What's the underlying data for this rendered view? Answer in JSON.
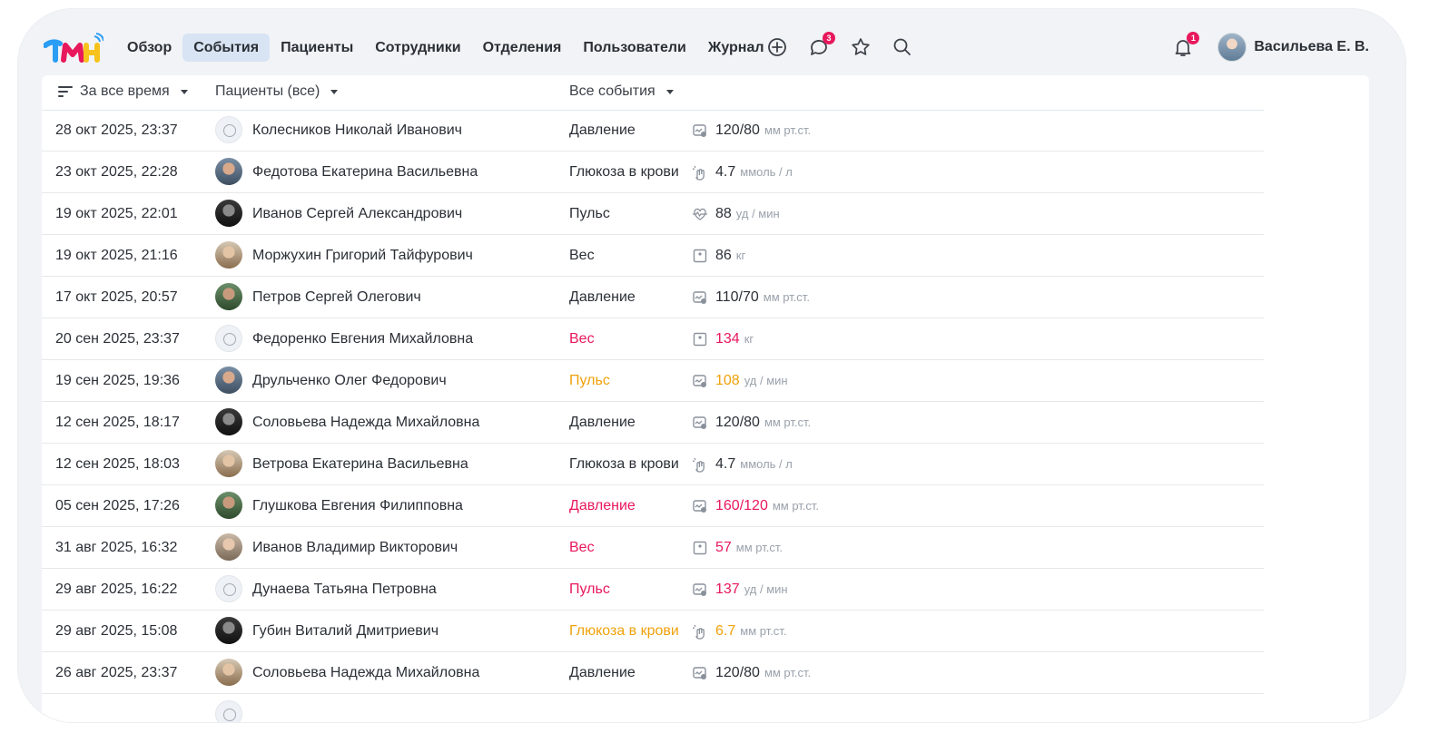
{
  "nav": {
    "items": [
      {
        "label": "Обзор",
        "active": false
      },
      {
        "label": "События",
        "active": true
      },
      {
        "label": "Пациенты",
        "active": false
      },
      {
        "label": "Сотрудники",
        "active": false
      },
      {
        "label": "Отделения",
        "active": false
      },
      {
        "label": "Пользователи",
        "active": false
      },
      {
        "label": "Журнал",
        "active": false
      }
    ],
    "icons": [
      "add-circle-icon",
      "chat-icon",
      "star-icon",
      "search-icon"
    ],
    "chat_badge": "3",
    "notifications_badge": "1"
  },
  "user": {
    "name": "Васильева Е. В."
  },
  "filters": {
    "period": "За все время",
    "patients": "Пациенты (все)",
    "events": "Все события"
  },
  "colors": {
    "accent_bg": "#d8e4f3",
    "alert": "#e8185c",
    "warning": "#f0a10a"
  },
  "events": [
    {
      "date": "28 окт 2025, 23:37",
      "patient": "Колесников Николай Иванович",
      "type": "Давление",
      "value": "120/80",
      "unit": "мм рт.ст.",
      "status": "normal",
      "icon": "pressure-icon",
      "avatar": "placeholder"
    },
    {
      "date": "23 окт 2025, 22:28",
      "patient": "Федотова Екатерина Васильевна",
      "type": "Глюкоза в крови",
      "value": "4.7",
      "unit": "ммоль / л",
      "status": "normal",
      "icon": "glucose-icon",
      "avatar": "photo"
    },
    {
      "date": "19 окт 2025, 22:01",
      "patient": "Иванов Сергей Александрович",
      "type": "Пульс",
      "value": "88",
      "unit": "уд / мин",
      "status": "normal",
      "icon": "heart-rate-icon",
      "avatar": "photo"
    },
    {
      "date": "19 окт 2025, 21:16",
      "patient": "Моржухин Григорий Тайфурович",
      "type": "Вес",
      "value": "86",
      "unit": "кг",
      "status": "normal",
      "icon": "scale-icon",
      "avatar": "photo"
    },
    {
      "date": "17 окт 2025, 20:57",
      "patient": "Петров Сергей Олегович",
      "type": "Давление",
      "value": "110/70",
      "unit": "мм рт.ст.",
      "status": "normal",
      "icon": "pressure-icon",
      "avatar": "photo"
    },
    {
      "date": "20 сен 2025, 23:37",
      "patient": "Федоренко Евгения Михайловна",
      "type": "Вес",
      "value": "134",
      "unit": "кг",
      "status": "alert",
      "icon": "scale-icon",
      "avatar": "placeholder"
    },
    {
      "date": "19 сен 2025, 19:36",
      "patient": "Друльченко Олег Федорович",
      "type": "Пульс",
      "value": "108",
      "unit": "уд / мин",
      "status": "warning",
      "icon": "pressure-icon",
      "avatar": "photo"
    },
    {
      "date": "12 сен 2025, 18:17",
      "patient": "Соловьева Надежда Михайловна",
      "type": "Давление",
      "value": "120/80",
      "unit": "мм рт.ст.",
      "status": "normal",
      "icon": "pressure-icon",
      "avatar": "photo"
    },
    {
      "date": "12 сен 2025, 18:03",
      "patient": "Ветрова Екатерина Васильевна",
      "type": "Глюкоза в крови",
      "value": "4.7",
      "unit": "ммоль / л",
      "status": "normal",
      "icon": "glucose-icon",
      "avatar": "photo"
    },
    {
      "date": "05 сен 2025, 17:26",
      "patient": "Глушкова Евгения Филипповна",
      "type": "Давление",
      "value": "160/120",
      "unit": "мм рт.ст.",
      "status": "alert",
      "icon": "pressure-icon",
      "avatar": "photo"
    },
    {
      "date": "31 авг 2025, 16:32",
      "patient": "Иванов Владимир Викторович",
      "type": "Вес",
      "value": "57",
      "unit": "мм рт.ст.",
      "status": "alert",
      "icon": "scale-icon",
      "avatar": "photo"
    },
    {
      "date": "29 авг 2025, 16:22",
      "patient": "Дунаева Татьяна Петровна",
      "type": "Пульс",
      "value": "137",
      "unit": "уд / мин",
      "status": "alert",
      "icon": "pressure-icon",
      "avatar": "placeholder"
    },
    {
      "date": "29 авг 2025, 15:08",
      "patient": "Губин Виталий Дмитриевич",
      "type": "Глюкоза в крови",
      "value": "6.7",
      "unit": "мм рт.ст.",
      "status": "warning",
      "icon": "glucose-icon",
      "avatar": "photo"
    },
    {
      "date": "26 авг 2025, 23:37",
      "patient": "Соловьева Надежда Михайловна",
      "type": "Давление",
      "value": "120/80",
      "unit": "мм рт.ст.",
      "status": "normal",
      "icon": "pressure-icon",
      "avatar": "photo"
    }
  ]
}
